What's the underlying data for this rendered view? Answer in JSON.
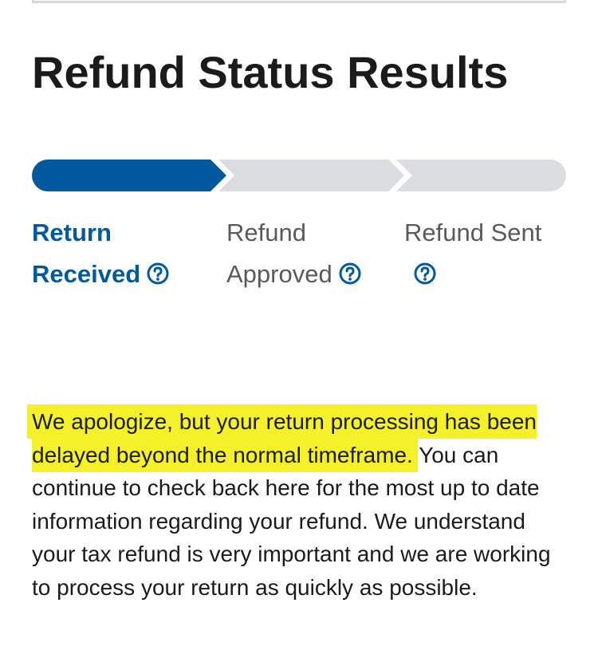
{
  "page": {
    "title": "Refund Status Results"
  },
  "tracker": {
    "current_step": 1,
    "total_steps": 3,
    "active_color": "#00599c",
    "inactive_color": "#dcdde0",
    "steps": [
      {
        "line1": "Return",
        "line2": "Received",
        "state": "active"
      },
      {
        "line1": "Refund",
        "line2": "Approved",
        "state": "inactive"
      },
      {
        "line1": "Refund Sent",
        "line2": "",
        "state": "inactive"
      }
    ],
    "help_icon": "question-circle-icon"
  },
  "message": {
    "highlighted": "We apologize, but your return processing has been delayed beyond the normal timeframe.",
    "rest": " You can continue to check back here for the most up to date information regarding your refund. We understand your tax refund is very important and we are working to process your return as quickly as possible.",
    "highlight_color": "#f4f12b"
  }
}
